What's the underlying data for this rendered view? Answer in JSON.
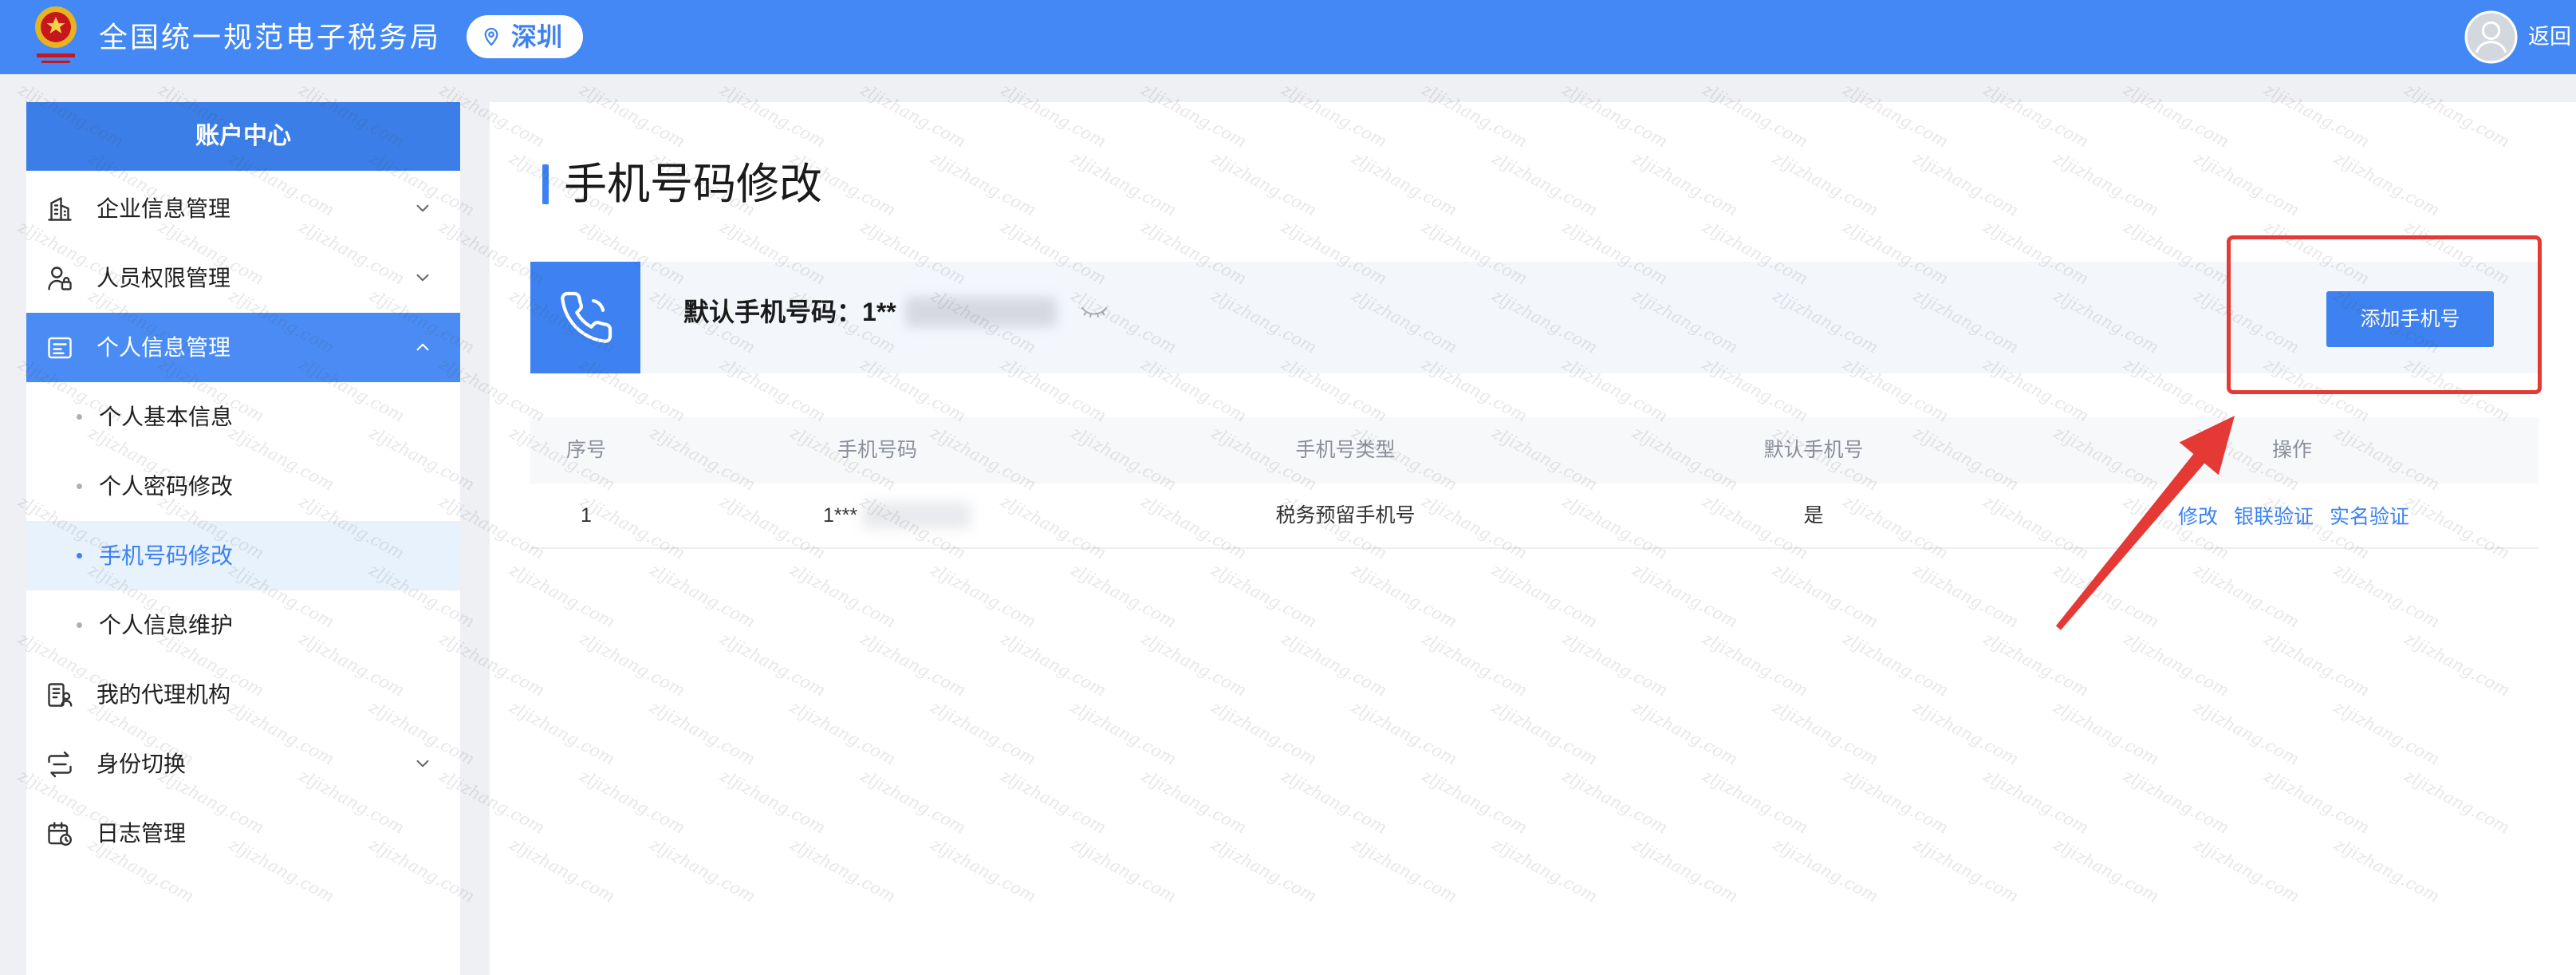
{
  "colors": {
    "primary": "#3d82f0",
    "header": "#4388f5",
    "sidebar_title": "#3b7ee7",
    "active_item": "#4b8cf4",
    "active_sub_bg": "#e8f2fd",
    "card_bg": "#f3f7fc",
    "page_bg": "#eef0f4",
    "annotation": "#e53935"
  },
  "header": {
    "logo_icon": "tax-emblem-logo",
    "title": "全国统一规范电子税务局",
    "location_icon": "map-pin-icon",
    "location": "深圳",
    "avatar_icon": "user-avatar-icon",
    "back_label": "返回"
  },
  "sidebar": {
    "title": "账户中心",
    "items": [
      {
        "label": "企业信息管理",
        "icon": "building-icon",
        "expandable": true,
        "expanded": false
      },
      {
        "label": "人员权限管理",
        "icon": "user-lock-icon",
        "expandable": true,
        "expanded": false
      },
      {
        "label": "个人信息管理",
        "icon": "id-card-icon",
        "expandable": true,
        "expanded": true,
        "active": true,
        "children": [
          {
            "label": "个人基本信息"
          },
          {
            "label": "个人密码修改"
          },
          {
            "label": "手机号码修改",
            "active": true
          },
          {
            "label": "个人信息维护"
          }
        ]
      },
      {
        "label": "我的代理机构",
        "icon": "agency-icon"
      },
      {
        "label": "身份切换",
        "icon": "switch-identity-icon",
        "expandable": true,
        "expanded": false
      },
      {
        "label": "日志管理",
        "icon": "log-calendar-icon"
      }
    ]
  },
  "main": {
    "title": "手机号码修改",
    "default_phone": {
      "icon": "phone-icon",
      "label": "默认手机号码：",
      "value": "1**",
      "masked": true,
      "visibility_icon": "eye-closed-icon"
    },
    "add_button": "添加手机号",
    "table": {
      "columns": [
        "序号",
        "手机号码",
        "手机号类型",
        "默认手机号",
        "操作"
      ],
      "rows": [
        {
          "index": "1",
          "phone": "1***",
          "type": "税务预留手机号",
          "is_default": "是",
          "actions": [
            "修改",
            "银联验证",
            "实名验证"
          ]
        }
      ]
    }
  },
  "watermark": {
    "text": "zljizhang.com"
  }
}
